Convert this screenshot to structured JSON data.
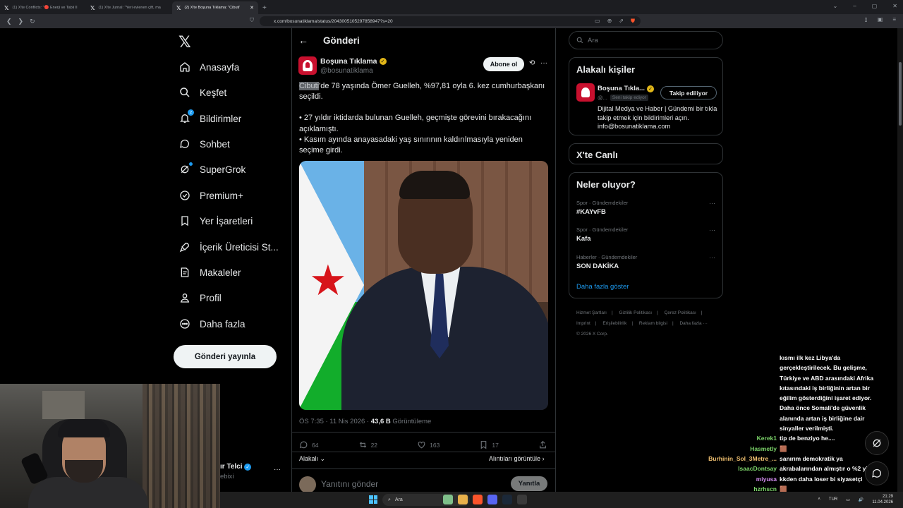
{
  "browser": {
    "tabs": [
      {
        "label": "(1) X'te Conflicts: \"🔴 Enerji ve Tabii Il",
        "active": false
      },
      {
        "label": "(1) X'te Jurnal: \"Yeri evlenen çift, ma",
        "active": false
      },
      {
        "label": "(2) X'te Boşuna Tıklama: \"Cibuti'",
        "active": true
      }
    ],
    "url": "x.com/bosunatiklama/status/2043005105297858947?s=20"
  },
  "sidebar": {
    "logo": "𝕏",
    "items": [
      {
        "label": "Anasayfa",
        "icon": "home-icon"
      },
      {
        "label": "Keşfet",
        "icon": "search-icon"
      },
      {
        "label": "Bildirimler",
        "icon": "bell-icon",
        "badge": "2"
      },
      {
        "label": "Sohbet",
        "icon": "chat-icon"
      },
      {
        "label": "SuperGrok",
        "icon": "grok-icon"
      },
      {
        "label": "Premium+",
        "icon": "premium-icon"
      },
      {
        "label": "Yer İşaretleri",
        "icon": "bookmark-icon"
      },
      {
        "label": "İçerik Üreticisi St...",
        "icon": "rocket-icon"
      },
      {
        "label": "Makaleler",
        "icon": "article-icon"
      },
      {
        "label": "Profil",
        "icon": "profile-icon"
      },
      {
        "label": "Daha fazla",
        "icon": "more-circle-icon"
      }
    ],
    "post_button": "Gönderi yayınla",
    "account_name": "ır Telci",
    "account_handle": "ebixi"
  },
  "header": {
    "title": "Gönderi"
  },
  "tweet": {
    "author_name": "Boşuna Tıklama",
    "author_handle": "@bosunatiklama",
    "subscribe_label": "Abone ol",
    "highlight": "Cibuti",
    "text_line1_rest": "'de 78 yaşında Ömer Guelleh, %97,81 oyla 6. kez cumhurbaşkanı seçildi.",
    "bullet1": "• 27 yıldır iktidarda bulunan Guelleh, geçmişte görevini bırakacağını açıklamıştı.",
    "bullet2": "• Kasım ayında anayasadaki yaş sınırının kaldırılmasıyla yeniden seçime girdi.",
    "time": "ÖS 7:35 · 11 Nis 2026 · ",
    "views": "43,6 B",
    "views_label": " Görüntüleme",
    "replies": "64",
    "reposts": "22",
    "likes": "163",
    "bookmarks": "17",
    "related_label": "Alakalı",
    "quotes_label": "Alıntıları görüntüle",
    "reply_placeholder": "Yanıtını gönder",
    "reply_button": "Yanıtla"
  },
  "right": {
    "search_placeholder": "Ara",
    "related_title": "Alakalı kişiler",
    "related_name": "Boşuna Tıkla...",
    "related_handle": "@...",
    "follows_you": "Seni takip ediyor",
    "following_button": "Takip ediliyor",
    "related_bio": "Dijital Medya ve Haber | Gündemi bir tıkla takip etmek için bildirimleri açın. info@bosunatiklama.com",
    "live_title": "X'te Canlı",
    "trends_title": "Neler oluyor?",
    "trends": [
      {
        "context": "Spor · Gündemdekiler",
        "name": "#KAYvFB"
      },
      {
        "context": "Spor · Gündemdekiler",
        "name": "Kafa"
      },
      {
        "context": "Haberler · Gündemdekiler",
        "name": "SON DAKİKA"
      }
    ],
    "show_more": "Daha fazla göster",
    "footer": [
      "Hizmet Şartları",
      "|",
      "Gizlilik Politikası",
      "|",
      "Çerez Politikası",
      "|",
      "Imprint",
      "|",
      "Erişilebilirlik",
      "|",
      "Reklam bilgisi",
      "|",
      "Daha fazla ···",
      "© 2026 X Corp."
    ]
  },
  "chat": {
    "lines": [
      {
        "user": "",
        "msg": "kısmı ilk kez Libya'da",
        "color": "#ffffff"
      },
      {
        "user": "",
        "msg": "gerçekleştirilecek. Bu gelişme,",
        "color": "#ffffff"
      },
      {
        "user": "",
        "msg": "Türkiye ve ABD arasındaki Afrika",
        "color": "#ffffff"
      },
      {
        "user": "",
        "msg": "kıtasındaki iş birliğinin artan bir",
        "color": "#ffffff"
      },
      {
        "user": "",
        "msg": "eğilim gösterdiğini işaret ediyor.",
        "color": "#ffffff"
      },
      {
        "user": "",
        "msg": "Daha önce Somali'de güvenlik",
        "color": "#ffffff"
      },
      {
        "user": "",
        "msg": "alanında artan iş birliğine dair",
        "color": "#ffffff"
      },
      {
        "user": "",
        "msg": "sinyaller verilmişti.",
        "color": "#ffffff"
      },
      {
        "user": "Kerek1",
        "msg": "tip de benziyo he....",
        "color": "#7cd46a"
      },
      {
        "user": "Hasmetly",
        "msg": "🟫",
        "color": "#7cd46a"
      },
      {
        "user": "Burhinin_Sol_3Metre_...",
        "msg": "sanırım demokratik ya",
        "color": "#f0c070"
      },
      {
        "user": "IsaacDontsay",
        "msg": "akrabalarından almıştır o %2 yi",
        "color": "#7cd46a"
      },
      {
        "user": "miyusa",
        "msg": "kkden daha loser bi siyasetçi",
        "color": "#d28cf0"
      },
      {
        "user": "hzrhscn",
        "msg": "🟫",
        "color": "#7cd46a"
      }
    ]
  },
  "taskbar": {
    "search": "Ara",
    "lang": "TUR",
    "time": "21:29",
    "date": "11.04.2026"
  }
}
